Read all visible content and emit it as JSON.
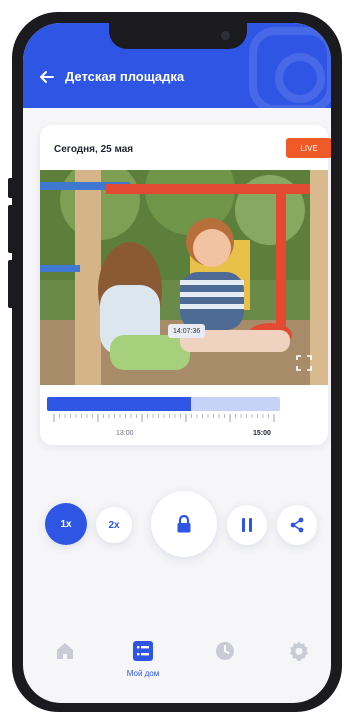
{
  "header": {
    "title": "Детская площадка",
    "back_icon": "arrow-left-icon",
    "background": "#2f55e4"
  },
  "player": {
    "date": "Сегодня, 25 мая",
    "live_badge": "LIVE",
    "live_color": "#f05a28",
    "current_time": "14:07:36",
    "progress": 0.62,
    "timeline_labels": [
      "13:00",
      "15:00"
    ]
  },
  "controls": {
    "speed_1x": "1x",
    "speed_2x": "2x",
    "selected_speed": "1x",
    "lock_icon": "lock-icon",
    "pause_icon": "pause-icon",
    "share_icon": "share-icon"
  },
  "tabbar": {
    "items": [
      {
        "icon": "home-icon",
        "label": ""
      },
      {
        "icon": "list-icon",
        "label": "Мой дом",
        "active": true
      },
      {
        "icon": "clock-icon",
        "label": ""
      },
      {
        "icon": "gear-icon",
        "label": ""
      }
    ]
  }
}
